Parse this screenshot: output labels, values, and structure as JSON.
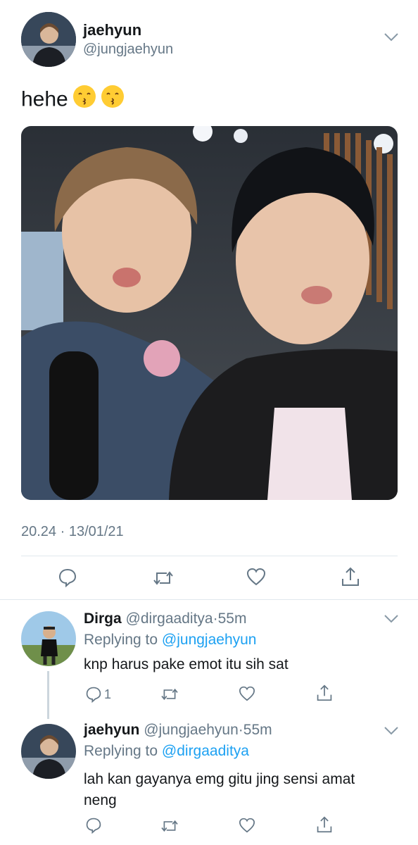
{
  "main_tweet": {
    "display_name": "jaehyun",
    "handle": "@jungjaehyun",
    "text": "hehe",
    "timestamp": "20.24 · 13/01/21",
    "emojis": [
      "kissing-face-icon",
      "kissing-face-icon"
    ]
  },
  "replies": [
    {
      "display_name": "Dirga",
      "handle": "@dirgaaditya",
      "sep": "·",
      "age": "55m",
      "replying_label": "Replying to",
      "replying_to": "@jungjaehyun",
      "text": "knp harus pake emot itu sih sat",
      "reply_count": "1"
    },
    {
      "display_name": "jaehyun",
      "handle": "@jungjaehyun",
      "sep": "·",
      "age": "55m",
      "replying_label": "Replying to",
      "replying_to": "@dirgaaditya",
      "text_line1": "lah kan gayanya emg gitu jing sensi amat",
      "text_line2": "neng",
      "reply_count": ""
    }
  ],
  "colors": {
    "accent": "#1da1f2",
    "muted": "#657786",
    "divider": "#e1e8ed"
  }
}
